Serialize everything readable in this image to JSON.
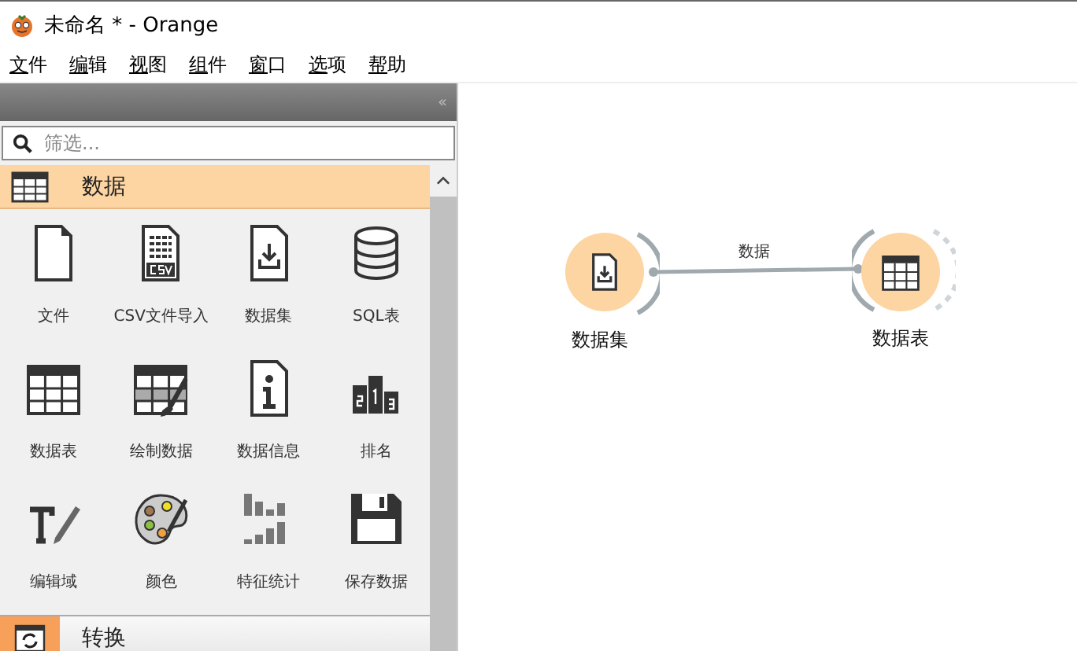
{
  "window": {
    "title": "未命名 * - Orange"
  },
  "menu": [
    "文件",
    "编辑",
    "视图",
    "组件",
    "窗口",
    "选项",
    "帮助"
  ],
  "toolbox": {
    "collapse": "‹‹",
    "search": {
      "placeholder": "筛选..."
    },
    "categories": [
      {
        "label": "数据",
        "expanded": true,
        "widgets": [
          "文件",
          "CSV文件导入",
          "数据集",
          "SQL表",
          "数据表",
          "绘制数据",
          "数据信息",
          "排名",
          "编辑域",
          "颜色",
          "特征统计",
          "保存数据"
        ]
      },
      {
        "label": "转换",
        "expanded": false
      }
    ]
  },
  "canvas": {
    "nodes": [
      {
        "label": "数据集"
      },
      {
        "label": "数据表"
      }
    ],
    "links": [
      {
        "label": "数据"
      }
    ]
  }
}
